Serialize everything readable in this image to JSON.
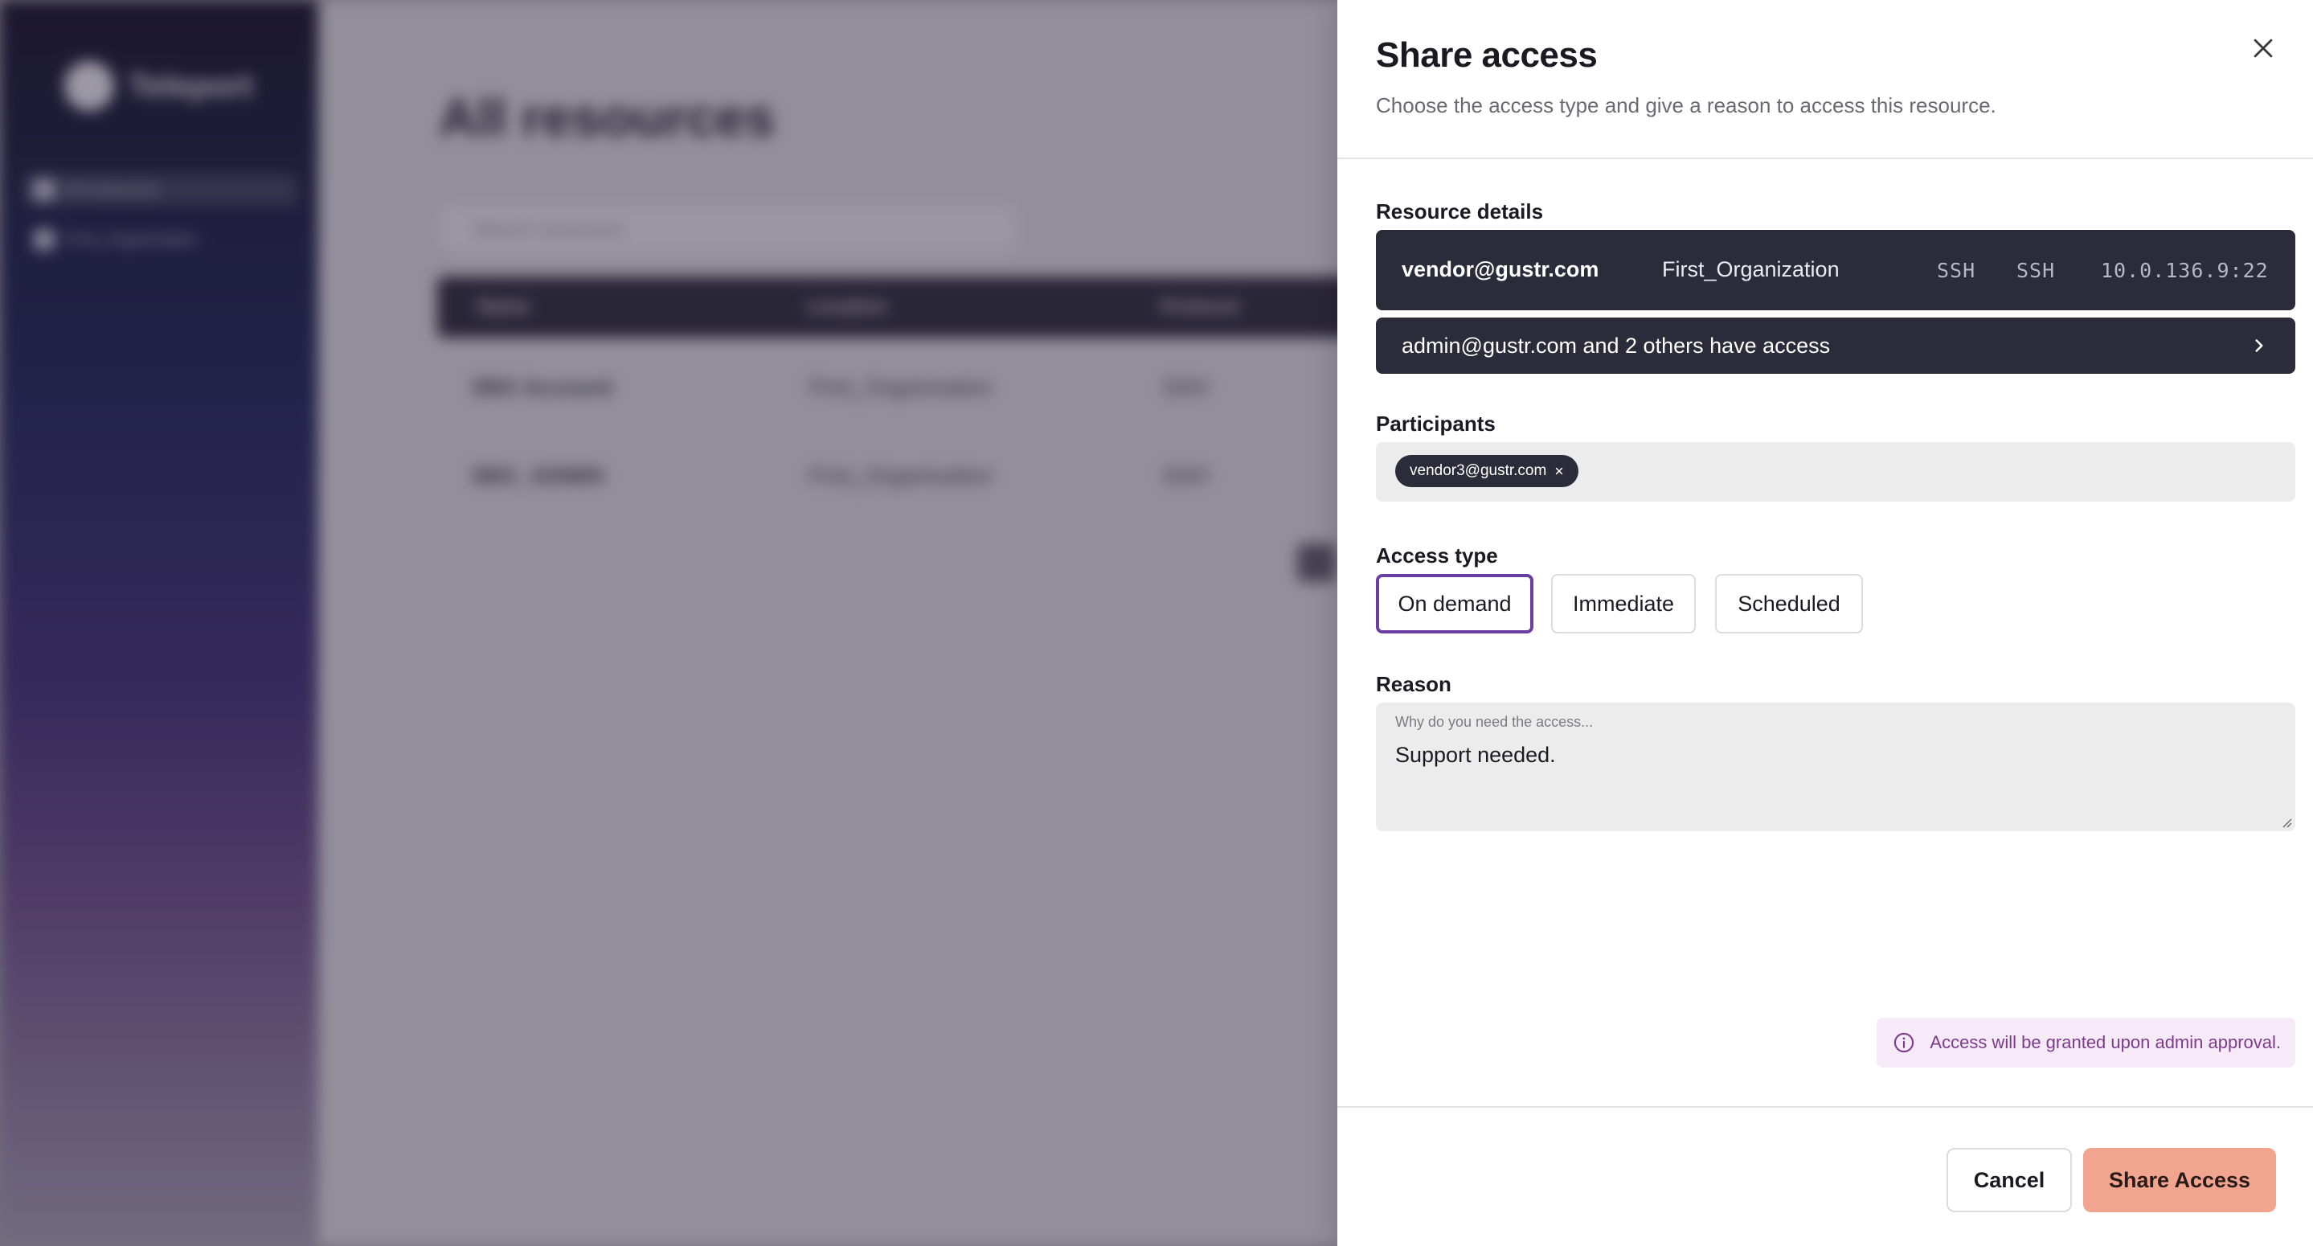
{
  "background": {
    "logo_text": "Teleport",
    "nav": [
      "All resources",
      "First_Organization"
    ],
    "page_title": "All resources",
    "search_placeholder": "Search resources",
    "table": {
      "headers": [
        "Name",
        "Location",
        "Protocol"
      ],
      "rows": [
        [
          "SBX Account",
          "First_Organization",
          "SSH"
        ],
        [
          "SBX_ADMIN",
          "First_Organization",
          "SSH"
        ]
      ]
    }
  },
  "drawer": {
    "title": "Share access",
    "subtitle": "Choose the access type and give a reason to access this resource.",
    "resource_details": {
      "label": "Resource details",
      "user": "vendor@gustr.com",
      "organization": "First_Organization",
      "protocol": "SSH",
      "type": "SSH",
      "address": "10.0.136.9:22",
      "access_summary": "admin@gustr.com and 2 others have access"
    },
    "participants": {
      "label": "Participants",
      "chips": [
        "vendor3@gustr.com"
      ]
    },
    "access_type": {
      "label": "Access type",
      "options": [
        "On demand",
        "Immediate",
        "Scheduled"
      ],
      "selected": "On demand"
    },
    "reason": {
      "label": "Reason",
      "placeholder": "Why do you need the access...",
      "value": "Support needed."
    },
    "info_message": "Access will be granted upon admin approval.",
    "footer": {
      "cancel_label": "Cancel",
      "submit_label": "Share Access"
    }
  },
  "colors": {
    "accent_border": "#6a3fa3",
    "submit_button": "#f2a58e",
    "dark_card": "#2c2b3a",
    "info_bg": "#f6eaf8",
    "info_text": "#7d3b8c"
  },
  "icons": {
    "close": "close-icon",
    "chevron": "chevron-right-icon",
    "chip_remove": "remove-chip-icon",
    "info": "info-icon"
  }
}
